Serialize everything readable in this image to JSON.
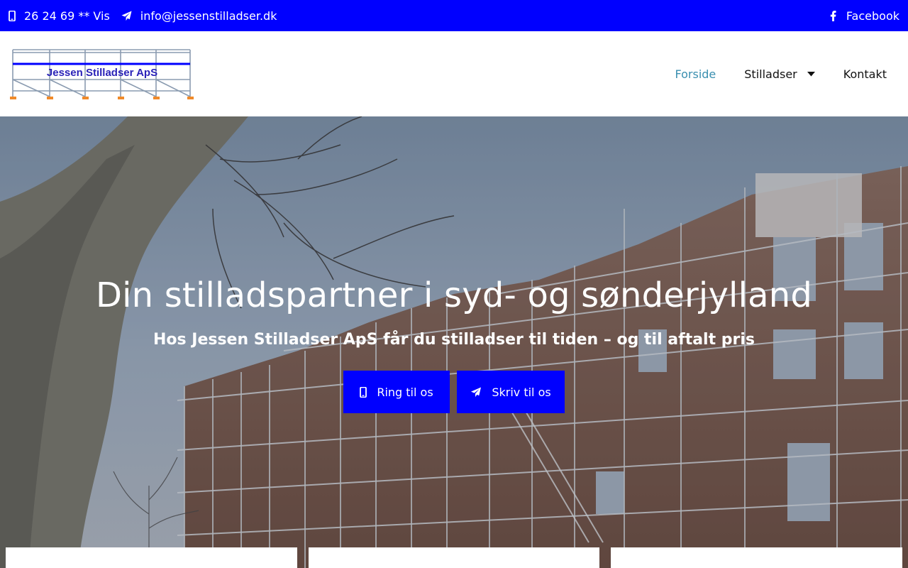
{
  "topbar": {
    "phone": "26 24 69 ** Vis",
    "email": "info@jessenstilladser.dk",
    "facebook": "Facebook",
    "phone_icon": "mobile-icon",
    "email_icon": "paper-plane-icon",
    "facebook_icon": "facebook-icon",
    "background": "#0000ff"
  },
  "header": {
    "logo_text": "Jessen Stilladser ApS",
    "nav": [
      {
        "label": "Forside",
        "active": true
      },
      {
        "label": "Stilladser",
        "has_dropdown": true
      },
      {
        "label": "Kontakt"
      }
    ],
    "active_color": "#3a8fb0"
  },
  "hero": {
    "title": "Din stilladspartner i syd- og sønderjylland",
    "subtitle": "Hos Jessen Stilladser ApS får du stilladser til tiden – og til aftalt pris",
    "buttons": {
      "call": "Ring til os",
      "write": "Skriv til os"
    },
    "button_color": "#0000ff"
  }
}
